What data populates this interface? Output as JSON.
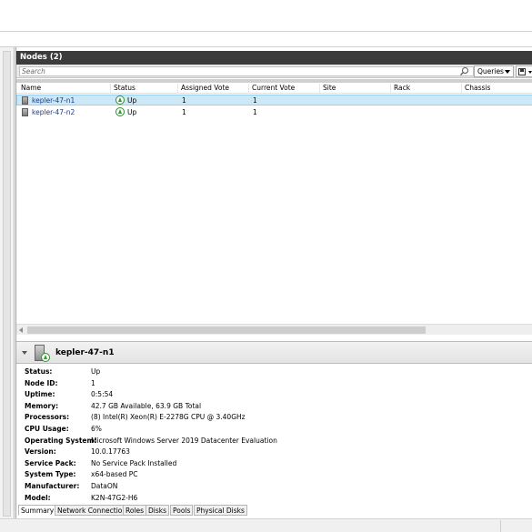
{
  "panel": {
    "title": "Nodes (2)",
    "search_placeholder": "Search",
    "queries_label": "Queries"
  },
  "columns": [
    "Name",
    "Status",
    "Assigned Vote",
    "Current Vote",
    "Site",
    "Rack",
    "Chassis"
  ],
  "nodes": [
    {
      "name": "kepler-47-n1",
      "status": "Up",
      "assigned_vote": "1",
      "current_vote": "1",
      "selected": true
    },
    {
      "name": "kepler-47-n2",
      "status": "Up",
      "assigned_vote": "1",
      "current_vote": "1",
      "selected": false
    }
  ],
  "detail": {
    "title": "kepler-47-n1",
    "properties": [
      {
        "label": "Status:",
        "value": "Up"
      },
      {
        "label": "Node ID:",
        "value": "1"
      },
      {
        "label": "Uptime:",
        "value": "0:5:54"
      },
      {
        "label": "Memory:",
        "value": "42.7 GB Available, 63.9 GB Total"
      },
      {
        "label": "Processors:",
        "value": "(8) Intel(R) Xeon(R) E-2278G CPU @ 3.40GHz"
      },
      {
        "label": "CPU Usage:",
        "value": "6%"
      },
      {
        "label": "Operating System:",
        "value": "Microsoft Windows Server 2019 Datacenter Evaluation"
      },
      {
        "label": "Version:",
        "value": "10.0.17763"
      },
      {
        "label": "Service Pack:",
        "value": "No Service Pack Installed"
      },
      {
        "label": "System Type:",
        "value": "x64-based PC"
      },
      {
        "label": "Manufacturer:",
        "value": "DataON"
      },
      {
        "label": "Model:",
        "value": "K2N-47G2-H6"
      }
    ]
  },
  "tabs": [
    "Summary",
    "Network Connections",
    "Roles",
    "Disks",
    "Pools",
    "Physical Disks"
  ],
  "colors": {
    "header_bg": "#3c3c3c",
    "selection_bg": "#cce8f7",
    "status_green": "#2e9a2e"
  }
}
